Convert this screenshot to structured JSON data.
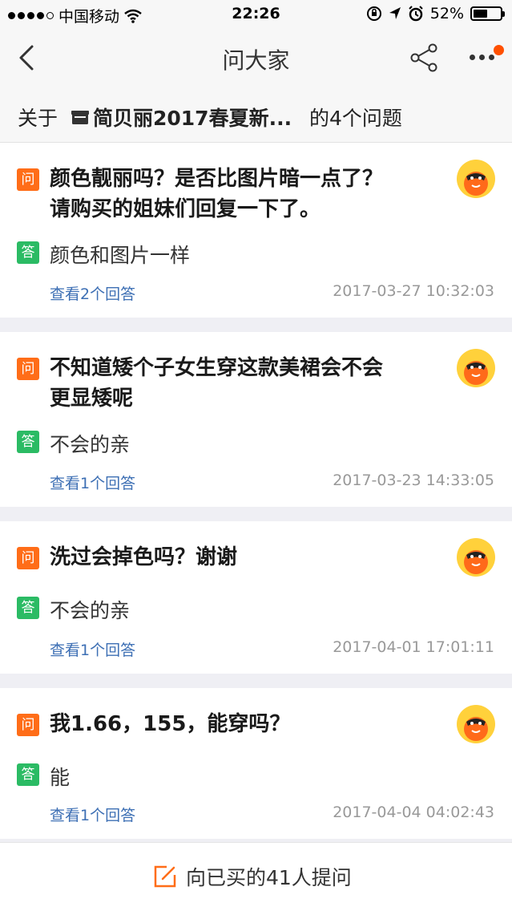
{
  "status": {
    "carrier": "中国移动",
    "time": "22:26",
    "battery": "52%",
    "battery_level": 0.52
  },
  "nav": {
    "title": "问大家"
  },
  "about": {
    "prefix": "关于",
    "product": "简贝丽2017春夏新...",
    "suffix": "的4个问题"
  },
  "tags": {
    "question": "问",
    "answer": "答"
  },
  "questions": [
    {
      "question": "颜色靓丽吗？是否比图片暗一点了？请购买的姐妹们回复一下了。",
      "answer": "颜色和图片一样",
      "link": "查看2个回答",
      "date": "2017-03-27 10:32:03"
    },
    {
      "question": "不知道矮个子女生穿这款美裙会不会更显矮呢",
      "answer": "不会的亲",
      "link": "查看1个回答",
      "date": "2017-03-23 14:33:05"
    },
    {
      "question": "洗过会掉色吗？谢谢",
      "answer": "不会的亲",
      "link": "查看1个回答",
      "date": "2017-04-01 17:01:11"
    },
    {
      "question": "我1.66，155，能穿吗？",
      "answer": "能",
      "link": "查看1个回答",
      "date": "2017-04-04 04:02:43"
    }
  ],
  "bottom": {
    "ask_label": "向已买的41人提问"
  },
  "colors": {
    "question_tag": "#ff6d18",
    "answer_tag": "#2bbb64",
    "link": "#3d6fb4",
    "accent": "#ff5000"
  }
}
